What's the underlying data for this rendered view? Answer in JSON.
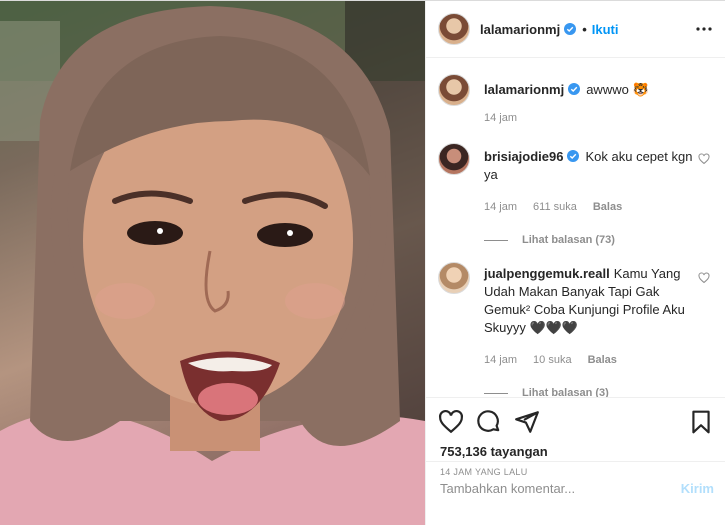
{
  "post": {
    "author": "lalamarionmj",
    "follow_label": "Ikuti",
    "caption": {
      "username": "lalamarionmj",
      "text": "awwwo 🐯",
      "time": "14 jam"
    },
    "comments": [
      {
        "username": "brisiajodie96",
        "text": "Kok aku cepet kgn ya",
        "time": "14 jam",
        "likes": "611 suka",
        "reply_label": "Balas",
        "view_replies": "Lihat balasan (73)"
      },
      {
        "username": "jualpenggemuk.reall",
        "text": "Kamu Yang Udah Makan Banyak Tapi Gak Gemuk² Coba Kunjungi Profile Aku Skuyyy 🖤🖤🖤",
        "time": "14 jam",
        "likes": "10 suka",
        "reply_label": "Balas",
        "view_replies": "Lihat balasan (3)"
      }
    ],
    "views": "753,136 tayangan",
    "posted_ago": "14 JAM YANG LALU",
    "composer": {
      "placeholder": "Tambahkan komentar...",
      "post_label": "Kirim"
    }
  },
  "colors": {
    "link_blue": "#0095f6",
    "muted": "#8e8e8e",
    "post_disabled": "#b2dffc"
  },
  "icons": [
    "verified-icon",
    "more-options-icon",
    "heart-icon",
    "comment-icon",
    "share-icon",
    "bookmark-icon"
  ]
}
